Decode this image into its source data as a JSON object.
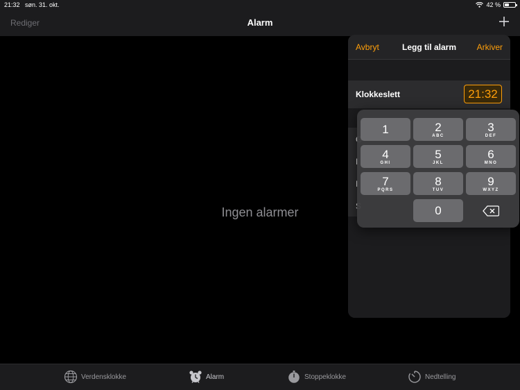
{
  "status": {
    "time": "21:32",
    "date": "søn. 31. okt.",
    "battery": "42 %"
  },
  "nav": {
    "edit": "Rediger",
    "title": "Alarm"
  },
  "main": {
    "empty": "Ingen alarmer"
  },
  "popover": {
    "cancel": "Avbryt",
    "title": "Legg til alarm",
    "save": "Arkiver",
    "time_label": "Klokkeslett",
    "time_value": "21:32",
    "option_letters": [
      "G",
      "I",
      "I",
      "S"
    ]
  },
  "keypad": {
    "keys": [
      {
        "digit": "1",
        "letters": ""
      },
      {
        "digit": "2",
        "letters": "ABC"
      },
      {
        "digit": "3",
        "letters": "DEF"
      },
      {
        "digit": "4",
        "letters": "GHI"
      },
      {
        "digit": "5",
        "letters": "JKL"
      },
      {
        "digit": "6",
        "letters": "MNO"
      },
      {
        "digit": "7",
        "letters": "PQRS"
      },
      {
        "digit": "8",
        "letters": "TUV"
      },
      {
        "digit": "9",
        "letters": "WXYZ"
      },
      {
        "digit": "0",
        "letters": ""
      }
    ]
  },
  "tabs": [
    "Verdensklokke",
    "Alarm",
    "Stoppeklokke",
    "Nedtelling"
  ],
  "colors": {
    "accent": "#ff9f0a",
    "background": "#000000",
    "panel": "#1c1c1e"
  }
}
